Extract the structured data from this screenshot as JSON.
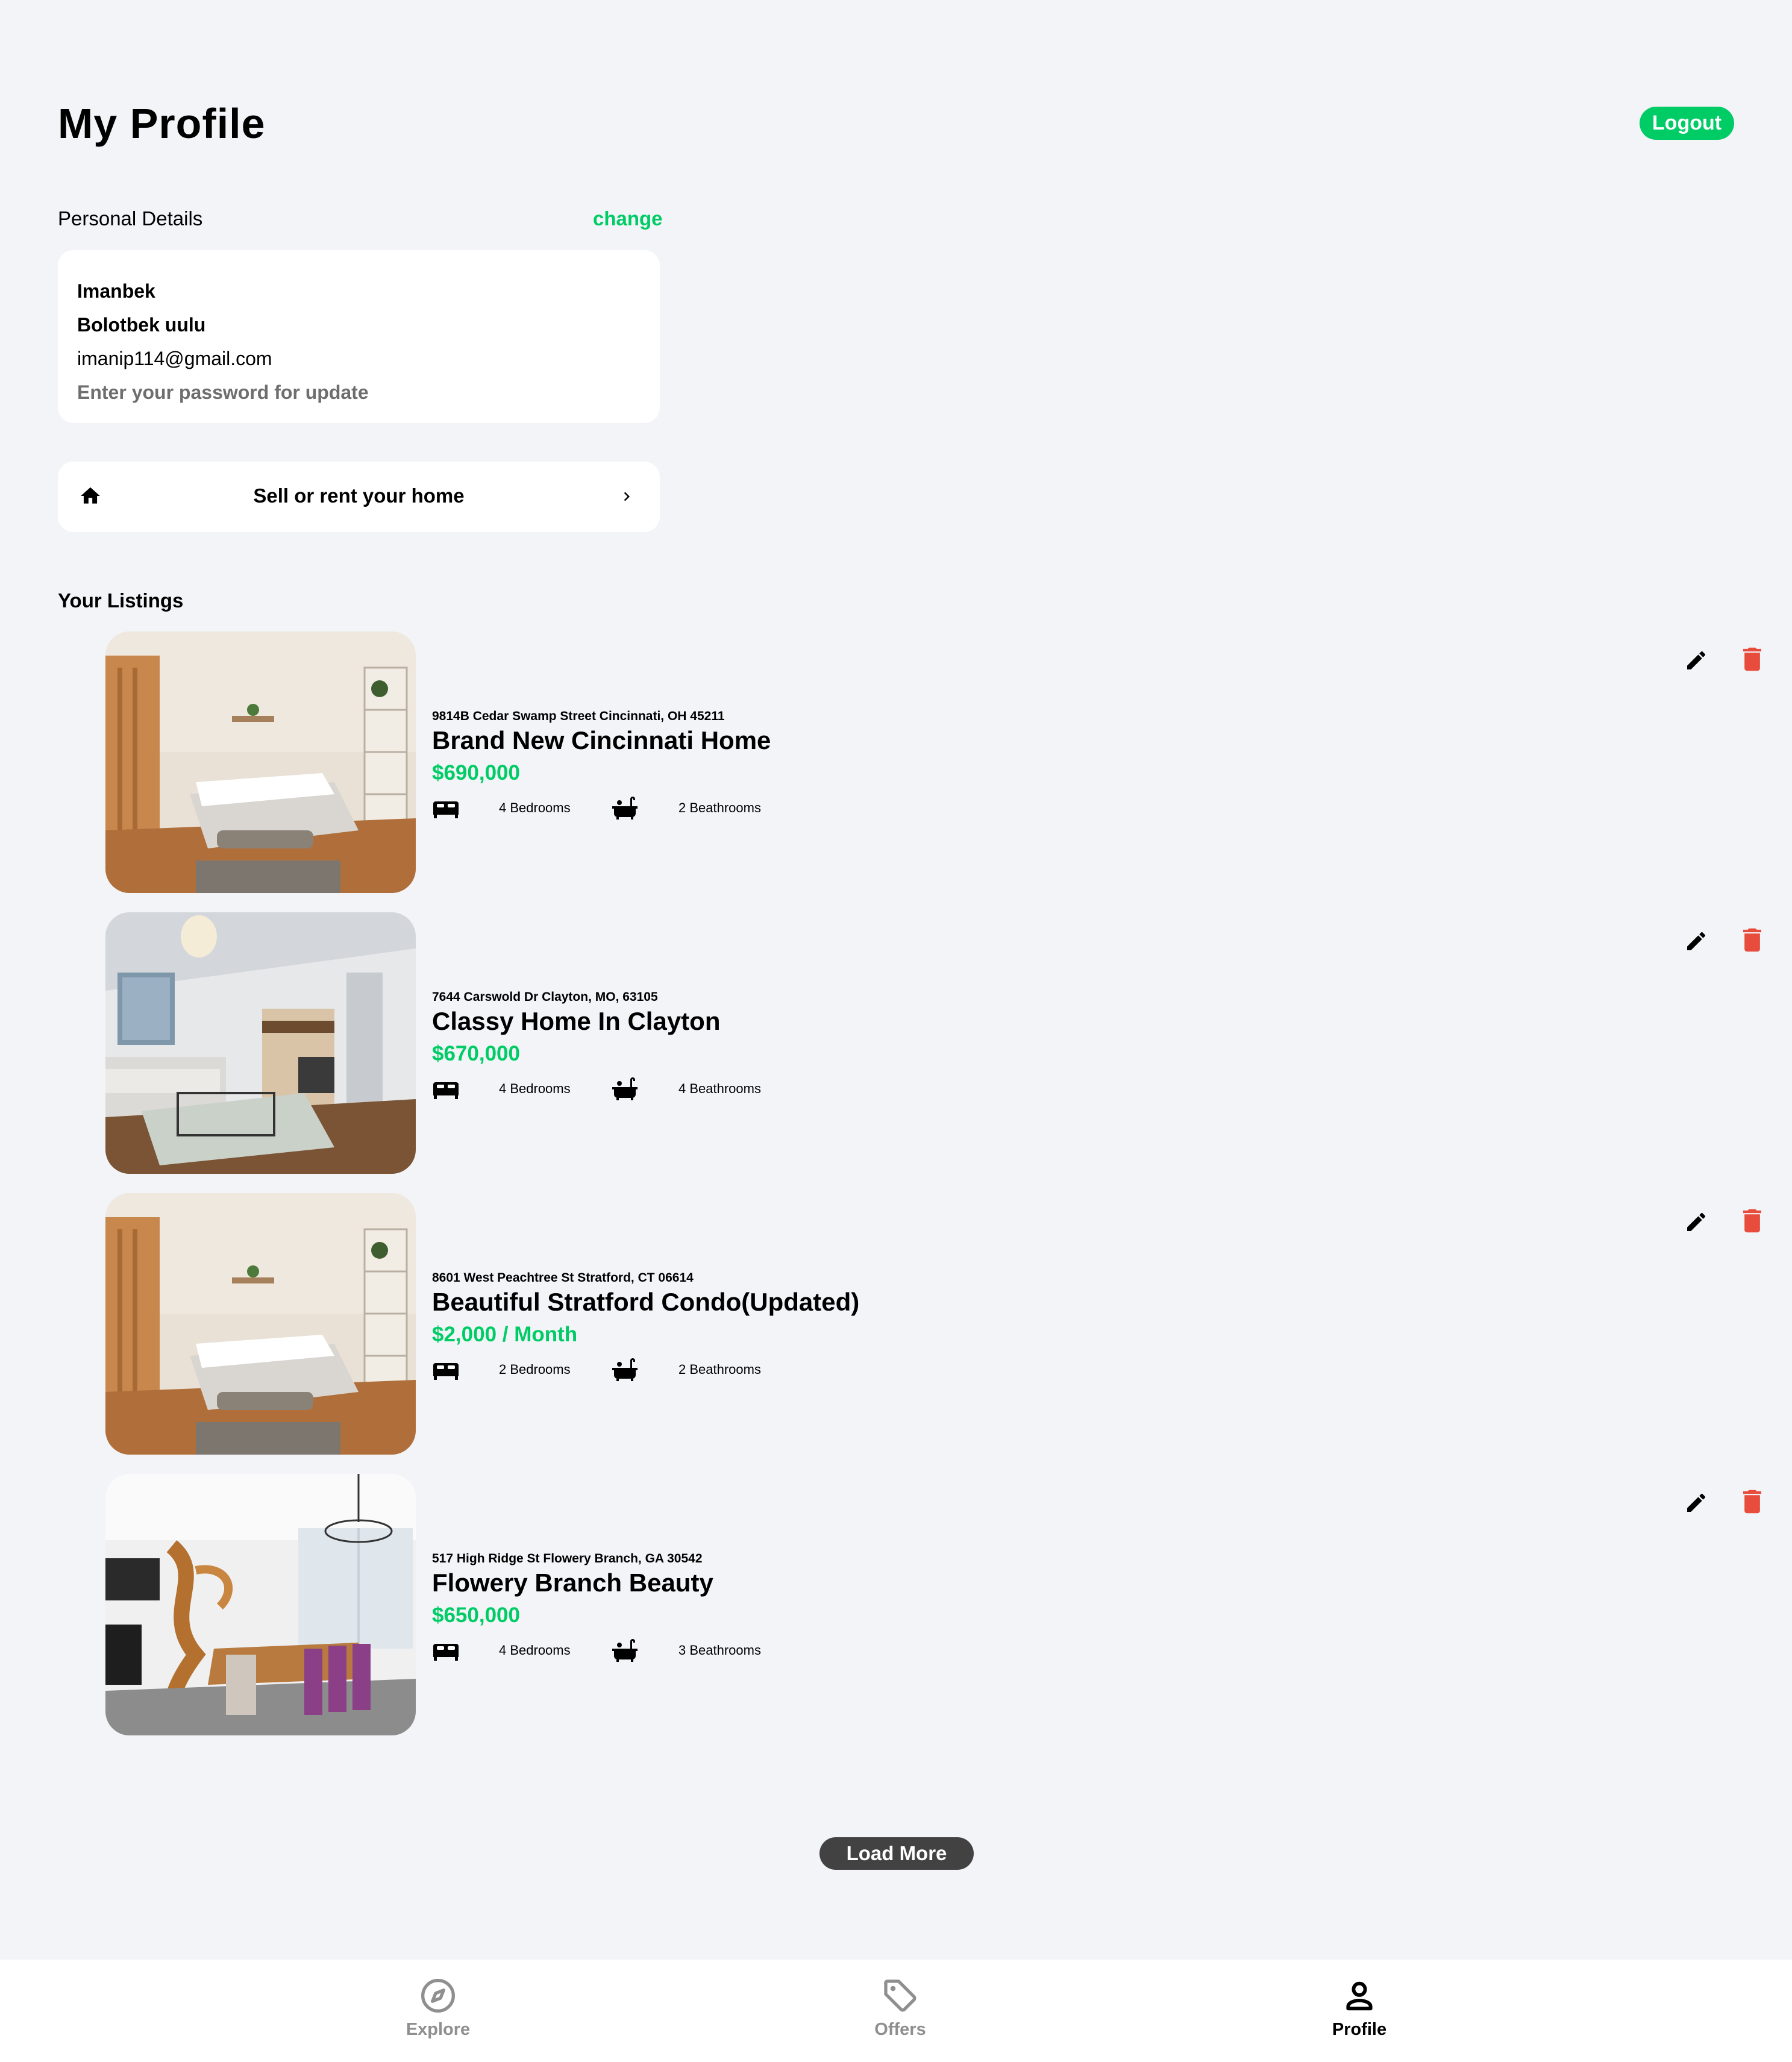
{
  "header": {
    "title": "My Profile",
    "logout_label": "Logout"
  },
  "personal_details": {
    "label": "Personal Details",
    "change_label": "change",
    "first_name": "Imanbek",
    "last_name": "Bolotbek uulu",
    "email": "imanip114@gmail.com",
    "password_placeholder": "Enter your password for update"
  },
  "sell_card": {
    "label": "Sell or rent your home"
  },
  "listings_section": {
    "title": "Your Listings",
    "items": [
      {
        "address": "9814B Cedar Swamp Street Cincinnati, OH 45211",
        "name": "Brand New Cincinnati Home",
        "price": "$690,000",
        "bedrooms": "4 Bedrooms",
        "bathrooms": "2 Beathrooms",
        "image": "bedroom"
      },
      {
        "address": "7644 Carswold Dr Clayton, MO, 63105",
        "name": "Classy Home In Clayton",
        "price": "$670,000",
        "bedrooms": "4 Bedrooms",
        "bathrooms": "4 Beathrooms",
        "image": "living-room"
      },
      {
        "address": "8601 West Peachtree St Stratford, CT 06614",
        "name": "Beautiful Stratford Condo(Updated)",
        "price": "$2,000 / Month",
        "bedrooms": "2 Bedrooms",
        "bathrooms": "2 Beathrooms",
        "image": "bedroom"
      },
      {
        "address": "517 High Ridge St Flowery Branch, GA 30542",
        "name": "Flowery Branch Beauty",
        "price": "$650,000",
        "bedrooms": "4 Bedrooms",
        "bathrooms": "3 Beathrooms",
        "image": "dining-room"
      }
    ]
  },
  "load_more_label": "Load More",
  "bottom_nav": {
    "items": [
      {
        "label": "Explore",
        "icon": "compass-icon",
        "active": false
      },
      {
        "label": "Offers",
        "icon": "tag-icon",
        "active": false
      },
      {
        "label": "Profile",
        "icon": "person-icon",
        "active": true
      }
    ]
  },
  "colors": {
    "accent": "#00cc66",
    "delete": "#e74c3c",
    "background": "#f2f4f8",
    "load_more": "#424242",
    "muted": "#8f8f8f"
  }
}
